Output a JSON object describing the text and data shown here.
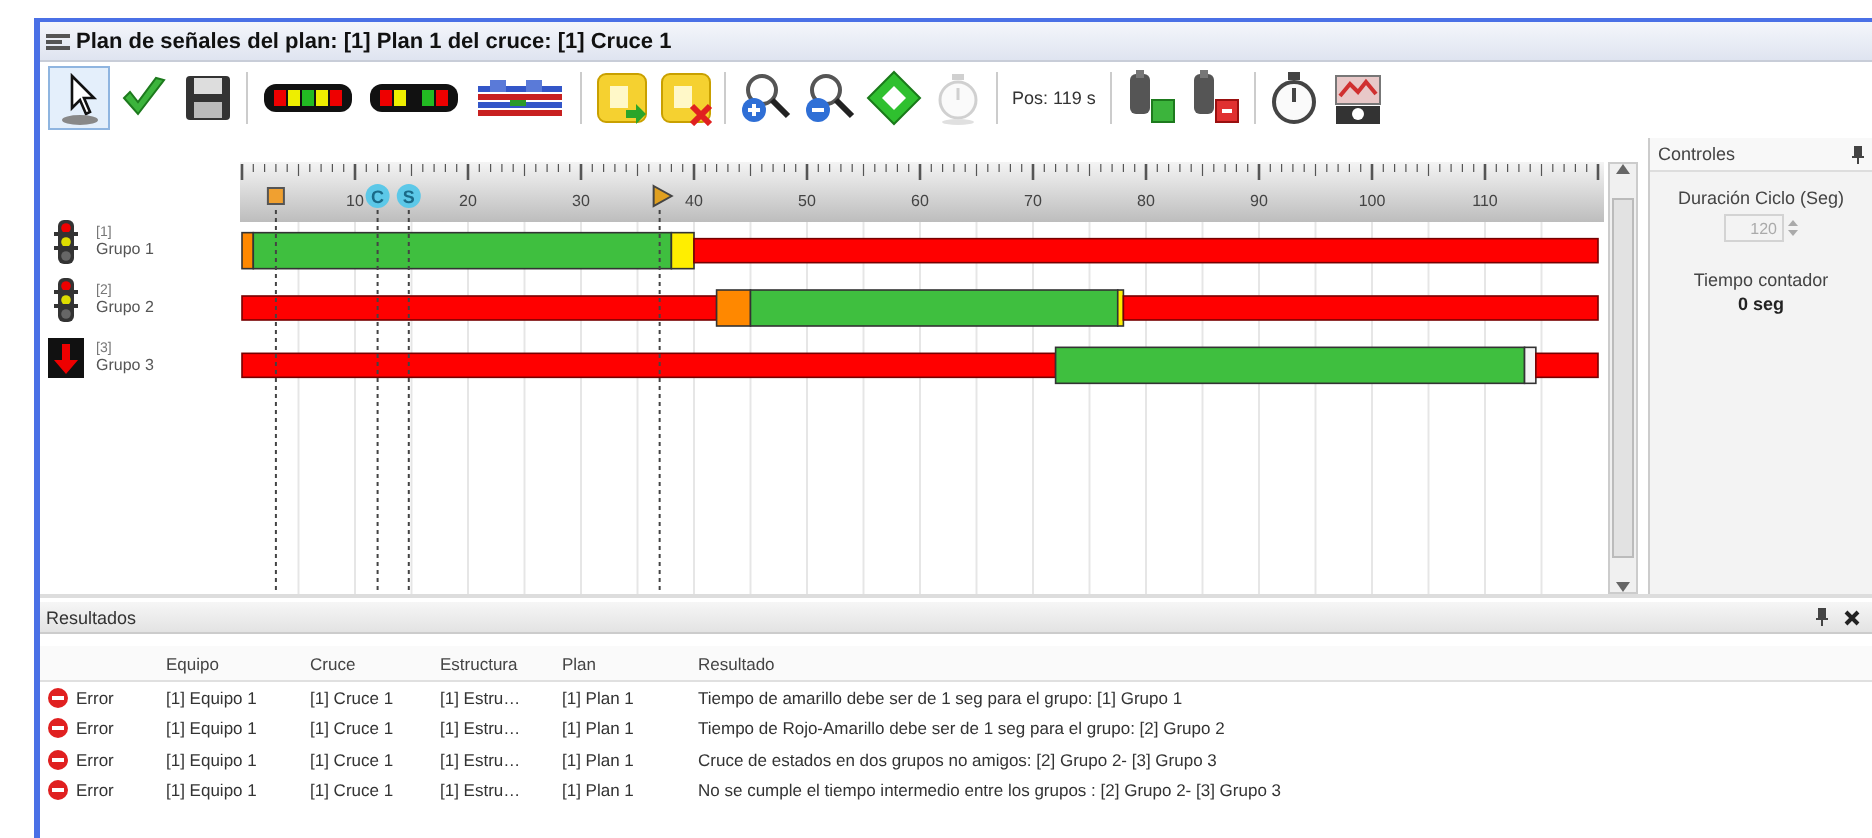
{
  "window": {
    "title": "Plan de señales del plan: [1] Plan 1 del cruce: [1] Cruce 1"
  },
  "toolbar": [
    {
      "kind": "pointer",
      "selected": true,
      "disabled": false
    },
    {
      "kind": "check",
      "selected": false,
      "disabled": false
    },
    {
      "kind": "save",
      "selected": false,
      "disabled": false
    },
    {
      "kind": "separator"
    },
    {
      "kind": "signal-bar",
      "selected": false,
      "disabled": false
    },
    {
      "kind": "signal-bar-alt",
      "selected": false,
      "disabled": false
    },
    {
      "kind": "sequence",
      "selected": false,
      "disabled": false
    },
    {
      "kind": "separator"
    },
    {
      "kind": "doc-add",
      "selected": false,
      "disabled": false
    },
    {
      "kind": "doc-remove",
      "selected": false,
      "disabled": false
    },
    {
      "kind": "separator"
    },
    {
      "kind": "zoom-in",
      "selected": false,
      "disabled": false
    },
    {
      "kind": "zoom-out",
      "selected": false,
      "disabled": false
    },
    {
      "kind": "fit",
      "selected": false,
      "disabled": false
    },
    {
      "kind": "timer",
      "selected": false,
      "disabled": true
    },
    {
      "kind": "separator"
    },
    {
      "kind": "text",
      "label": "Pos: 119 s"
    },
    {
      "kind": "separator"
    },
    {
      "kind": "device-add",
      "selected": false,
      "disabled": false
    },
    {
      "kind": "device-remove",
      "selected": false,
      "disabled": false
    },
    {
      "kind": "separator"
    },
    {
      "kind": "stopwatch",
      "selected": false,
      "disabled": false
    },
    {
      "kind": "monitor",
      "selected": false,
      "disabled": false
    }
  ],
  "timeline": {
    "chart_data": {
      "type": "bar",
      "orientation": "horizontal",
      "stacked": true,
      "grid": true,
      "categories": [
        "Grupo 1",
        "Grupo 2",
        "Grupo 3"
      ],
      "xlim": [
        0,
        120
      ],
      "xticks": [
        10,
        20,
        30,
        40,
        50,
        60,
        70,
        80,
        90,
        100,
        110
      ],
      "series": [
        {
          "color": "#ff0000",
          "values": [
            0,
            42,
            72
          ]
        },
        {
          "color": "#ff8800",
          "values": [
            1,
            3,
            0
          ]
        },
        {
          "color": "#3fbf3f",
          "values": [
            37,
            32.5,
            41.5
          ]
        },
        {
          "color": "#ffee00",
          "values": [
            2,
            0.5,
            0
          ]
        },
        {
          "color": "#f4f4f4",
          "values": [
            0,
            0,
            1
          ]
        },
        {
          "color": "#ff0000",
          "values": [
            80,
            42,
            5.5
          ]
        }
      ]
    },
    "markers": [
      {
        "kind": "square",
        "level": 0.025
      },
      {
        "kind": "circle",
        "label": "C",
        "level": 0.1
      },
      {
        "kind": "circle",
        "label": "S",
        "level": 0.123
      },
      {
        "kind": "arrow",
        "level": 0.308
      }
    ],
    "groups": [
      {
        "index": "[1]",
        "kind": "light"
      },
      {
        "index": "[2]",
        "kind": "light"
      },
      {
        "index": "[3]",
        "kind": "arrow"
      }
    ]
  },
  "controls": {
    "title": "Controles",
    "cycle_label": "Duración Ciclo (Seg)",
    "cycle": {
      "value": "120",
      "disabled": true
    },
    "counter_label": "Tiempo contador",
    "counter_value": "0 seg"
  },
  "results": {
    "title": "Resultados",
    "columns": [
      "Equipo",
      "Cruce",
      "Estructura",
      "Plan",
      "Resultado"
    ],
    "rows": [
      {
        "type": "Error",
        "cells": [
          "[1] Equipo 1",
          "[1] Cruce 1",
          "[1] Estru…",
          "[1] Plan 1",
          "Tiempo de amarillo debe ser de 1 seg para el grupo: [1] Grupo 1"
        ]
      },
      {
        "type": "Error",
        "cells": [
          "[1] Equipo 1",
          "[1] Cruce 1",
          "[1] Estru…",
          "[1] Plan 1",
          "Tiempo de Rojo-Amarillo debe ser de 1 seg para el grupo: [2] Grupo 2"
        ]
      },
      {
        "type": "Error",
        "cells": [
          "[1] Equipo 1",
          "[1] Cruce 1",
          "[1] Estru…",
          "[1] Plan 1",
          "Cruce de estados en dos grupos no amigos: [2] Grupo 2- [3] Grupo 3"
        ]
      },
      {
        "type": "Error",
        "cells": [
          "[1] Equipo 1",
          "[1] Cruce 1",
          "[1] Estru…",
          "[1] Plan 1",
          "No se cumple el tiempo intermedio entre los grupos : [2] Grupo 2- [3] Grupo 3"
        ]
      }
    ]
  }
}
